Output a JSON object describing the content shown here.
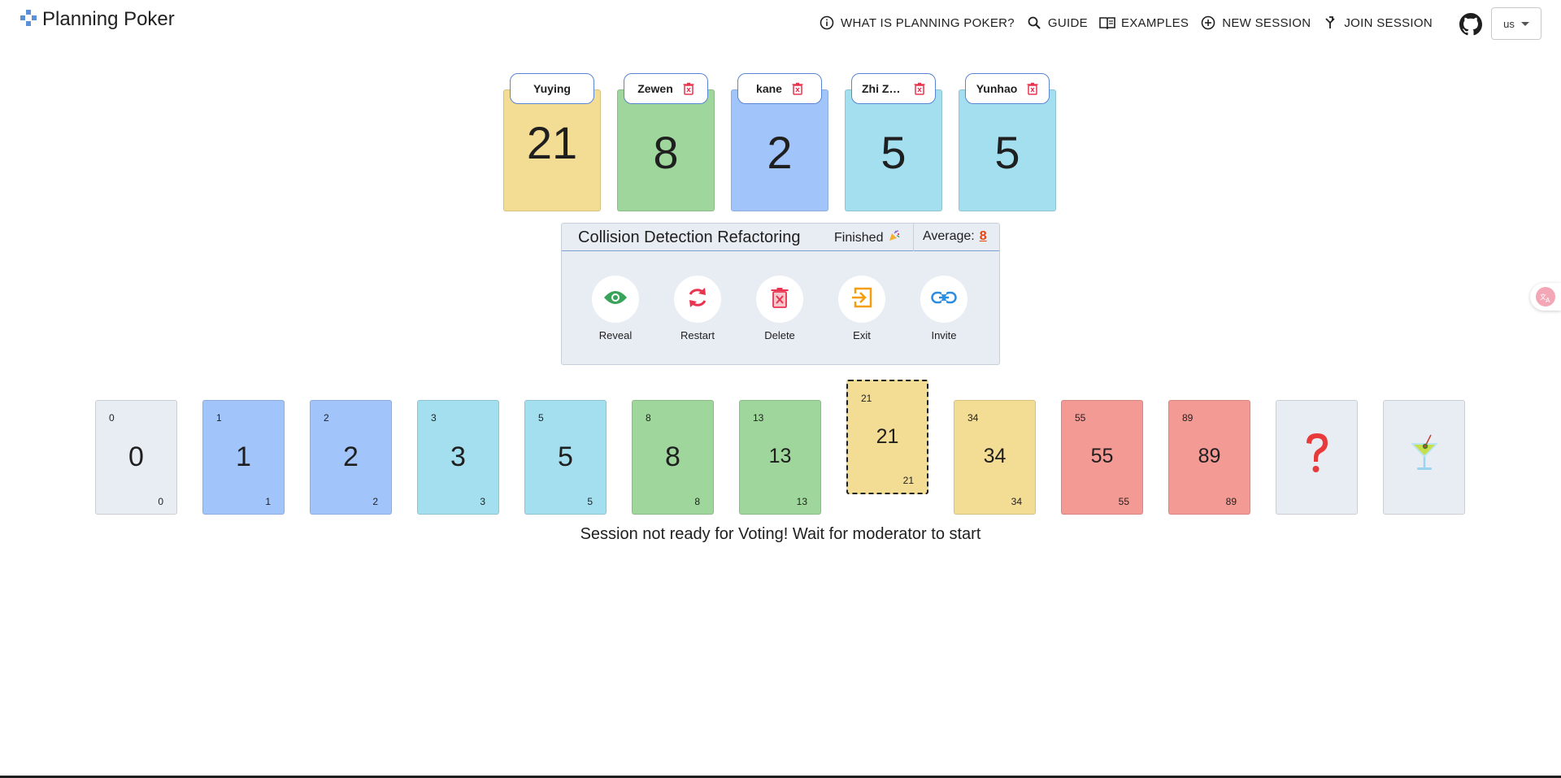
{
  "header": {
    "brand": "Planning Poker",
    "nav": [
      {
        "label": "WHAT IS PLANNING POKER?",
        "icon": "info-icon"
      },
      {
        "label": "GUIDE",
        "icon": "search-icon"
      },
      {
        "label": "EXAMPLES",
        "icon": "book-icon"
      },
      {
        "label": "NEW SESSION",
        "icon": "plus-circle-icon"
      },
      {
        "label": "JOIN SESSION",
        "icon": "merge-icon"
      }
    ],
    "language": "us"
  },
  "players": [
    {
      "name": "Yuying",
      "value": "21",
      "color": "#f3dd95",
      "deletable": false
    },
    {
      "name": "Zewen",
      "value": "8",
      "color": "#9fd69b",
      "deletable": true
    },
    {
      "name": "kane",
      "value": "2",
      "color": "#a1c5fb",
      "deletable": true
    },
    {
      "name": "Zhi Zh...",
      "value": "5",
      "color": "#a4dff0",
      "deletable": true
    },
    {
      "name": "Yunhao",
      "value": "5",
      "color": "#a4dff0",
      "deletable": true
    }
  ],
  "session": {
    "title": "Collision Detection Refactoring",
    "status": "Finished",
    "average_label": "Average:",
    "average_value": "8",
    "actions": [
      {
        "label": "Reveal",
        "icon": "eye-icon",
        "color": "#3aa35a"
      },
      {
        "label": "Restart",
        "icon": "refresh-icon",
        "color": "#e8344f"
      },
      {
        "label": "Delete",
        "icon": "delete-box-icon",
        "color": "#e8344f"
      },
      {
        "label": "Exit",
        "icon": "exit-icon",
        "color": "#f59e0b"
      },
      {
        "label": "Invite",
        "icon": "link-icon",
        "color": "#2b8de0"
      }
    ]
  },
  "deck": [
    {
      "value": "0",
      "color": "#e8ecf3"
    },
    {
      "value": "1",
      "color": "#a1c5fb"
    },
    {
      "value": "2",
      "color": "#a1c5fb"
    },
    {
      "value": "3",
      "color": "#a4dff0"
    },
    {
      "value": "5",
      "color": "#a4dff0"
    },
    {
      "value": "8",
      "color": "#9fd69b"
    },
    {
      "value": "13",
      "color": "#9fd69b"
    },
    {
      "value": "21",
      "color": "#f3dd95",
      "selected": true
    },
    {
      "value": "34",
      "color": "#f3dd95"
    },
    {
      "value": "55",
      "color": "#f39a94"
    },
    {
      "value": "89",
      "color": "#f39a94"
    },
    {
      "value": "?",
      "color": "#e8ecf3",
      "icon": "question-icon"
    },
    {
      "value": "coffee",
      "color": "#e8ecf3",
      "icon": "cocktail-icon"
    }
  ],
  "status_message": "Session not ready for Voting! Wait for moderator to start"
}
